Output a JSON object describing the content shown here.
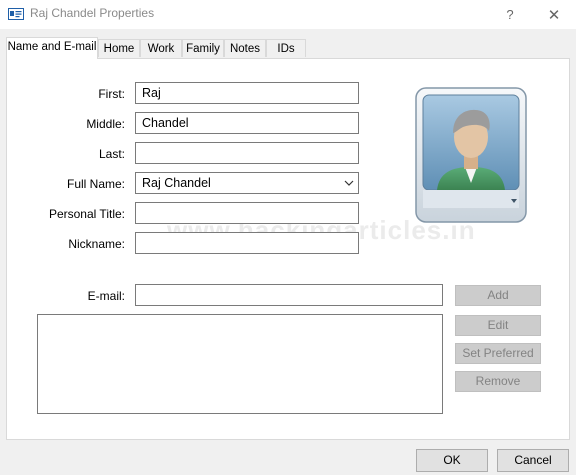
{
  "window": {
    "title": "Raj Chandel Properties",
    "help_glyph": "?",
    "close_glyph": "✕"
  },
  "tabs": [
    {
      "label": "Name and E-mail",
      "active": true
    },
    {
      "label": "Home"
    },
    {
      "label": "Work"
    },
    {
      "label": "Family"
    },
    {
      "label": "Notes"
    },
    {
      "label": "IDs"
    }
  ],
  "form": {
    "first_label": "First:",
    "first_value": "Raj",
    "middle_label": "Middle:",
    "middle_value": "Chandel",
    "last_label": "Last:",
    "last_value": "",
    "fullname_label": "Full Name:",
    "fullname_value": "Raj Chandel",
    "title_label": "Personal Title:",
    "title_value": "",
    "nickname_label": "Nickname:",
    "nickname_value": "",
    "email_label": "E-mail:",
    "email_value": ""
  },
  "email_buttons": {
    "add": "Add",
    "edit": "Edit",
    "set_preferred": "Set Preferred",
    "remove": "Remove"
  },
  "watermark": "www.hackingarticles.in",
  "footer": {
    "ok": "OK",
    "cancel": "Cancel"
  },
  "colors": {
    "avatar_bg": "#7fa9c9",
    "skin": "#e3c5a5",
    "shirt": "#4b9a66",
    "hair": "#9c9c9c"
  }
}
